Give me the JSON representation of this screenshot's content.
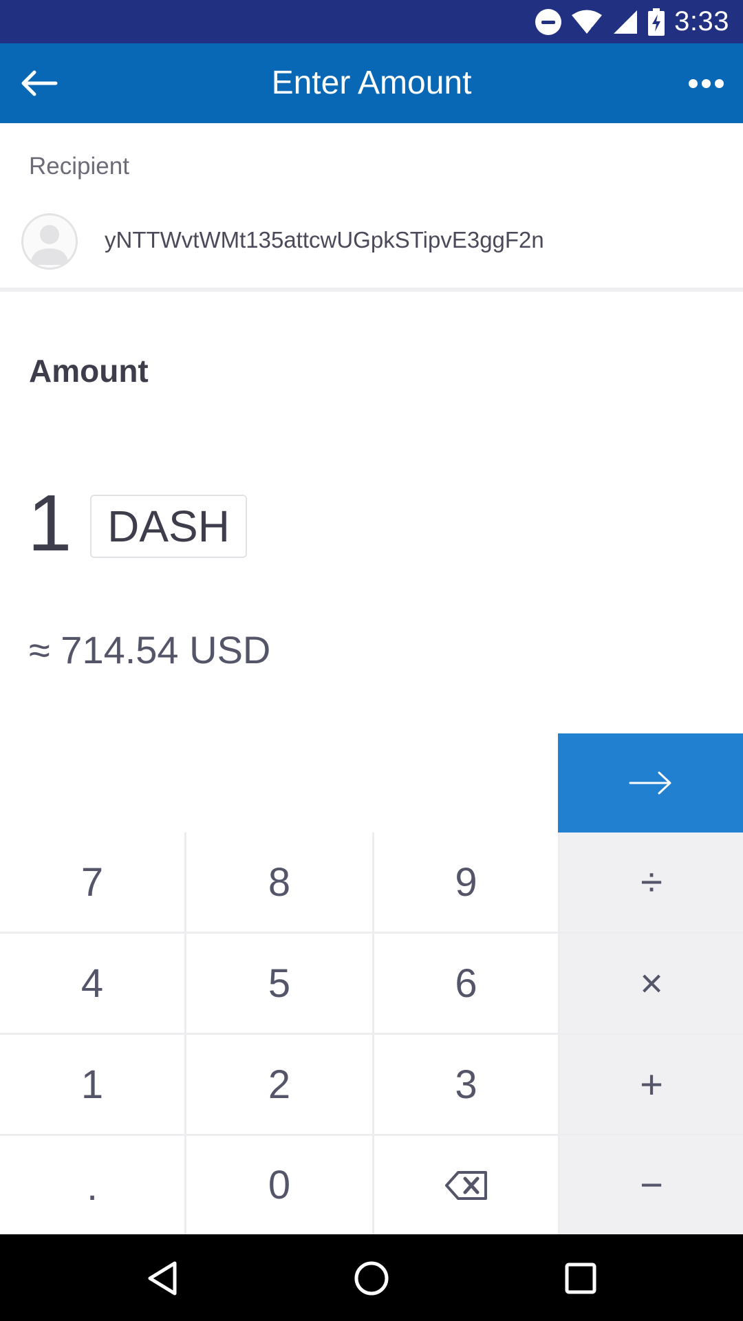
{
  "status_bar": {
    "time": "3:33"
  },
  "app_bar": {
    "title": "Enter Amount"
  },
  "recipient": {
    "label": "Recipient",
    "address": "yNTTWvtWMt135attcwUGpkSTipvE3ggF2n"
  },
  "amount": {
    "label": "Amount",
    "value": "1",
    "currency": "DASH",
    "fiat_equivalent": "≈ 714.54 USD"
  },
  "keypad": {
    "rows": [
      [
        "7",
        "8",
        "9",
        "÷"
      ],
      [
        "4",
        "5",
        "6",
        "×"
      ],
      [
        "1",
        "2",
        "3",
        "+"
      ],
      [
        ".",
        "0",
        "",
        "−"
      ]
    ]
  },
  "colors": {
    "status_bar": "#213080",
    "app_bar": "#0968b6",
    "next_button": "#2280d0",
    "operator_key": "#f0f0f2"
  },
  "icons": {
    "back": "arrow-left-icon",
    "more": "more-horizontal-icon",
    "next": "arrow-right-icon",
    "backspace": "backspace-icon",
    "avatar": "person-icon"
  }
}
